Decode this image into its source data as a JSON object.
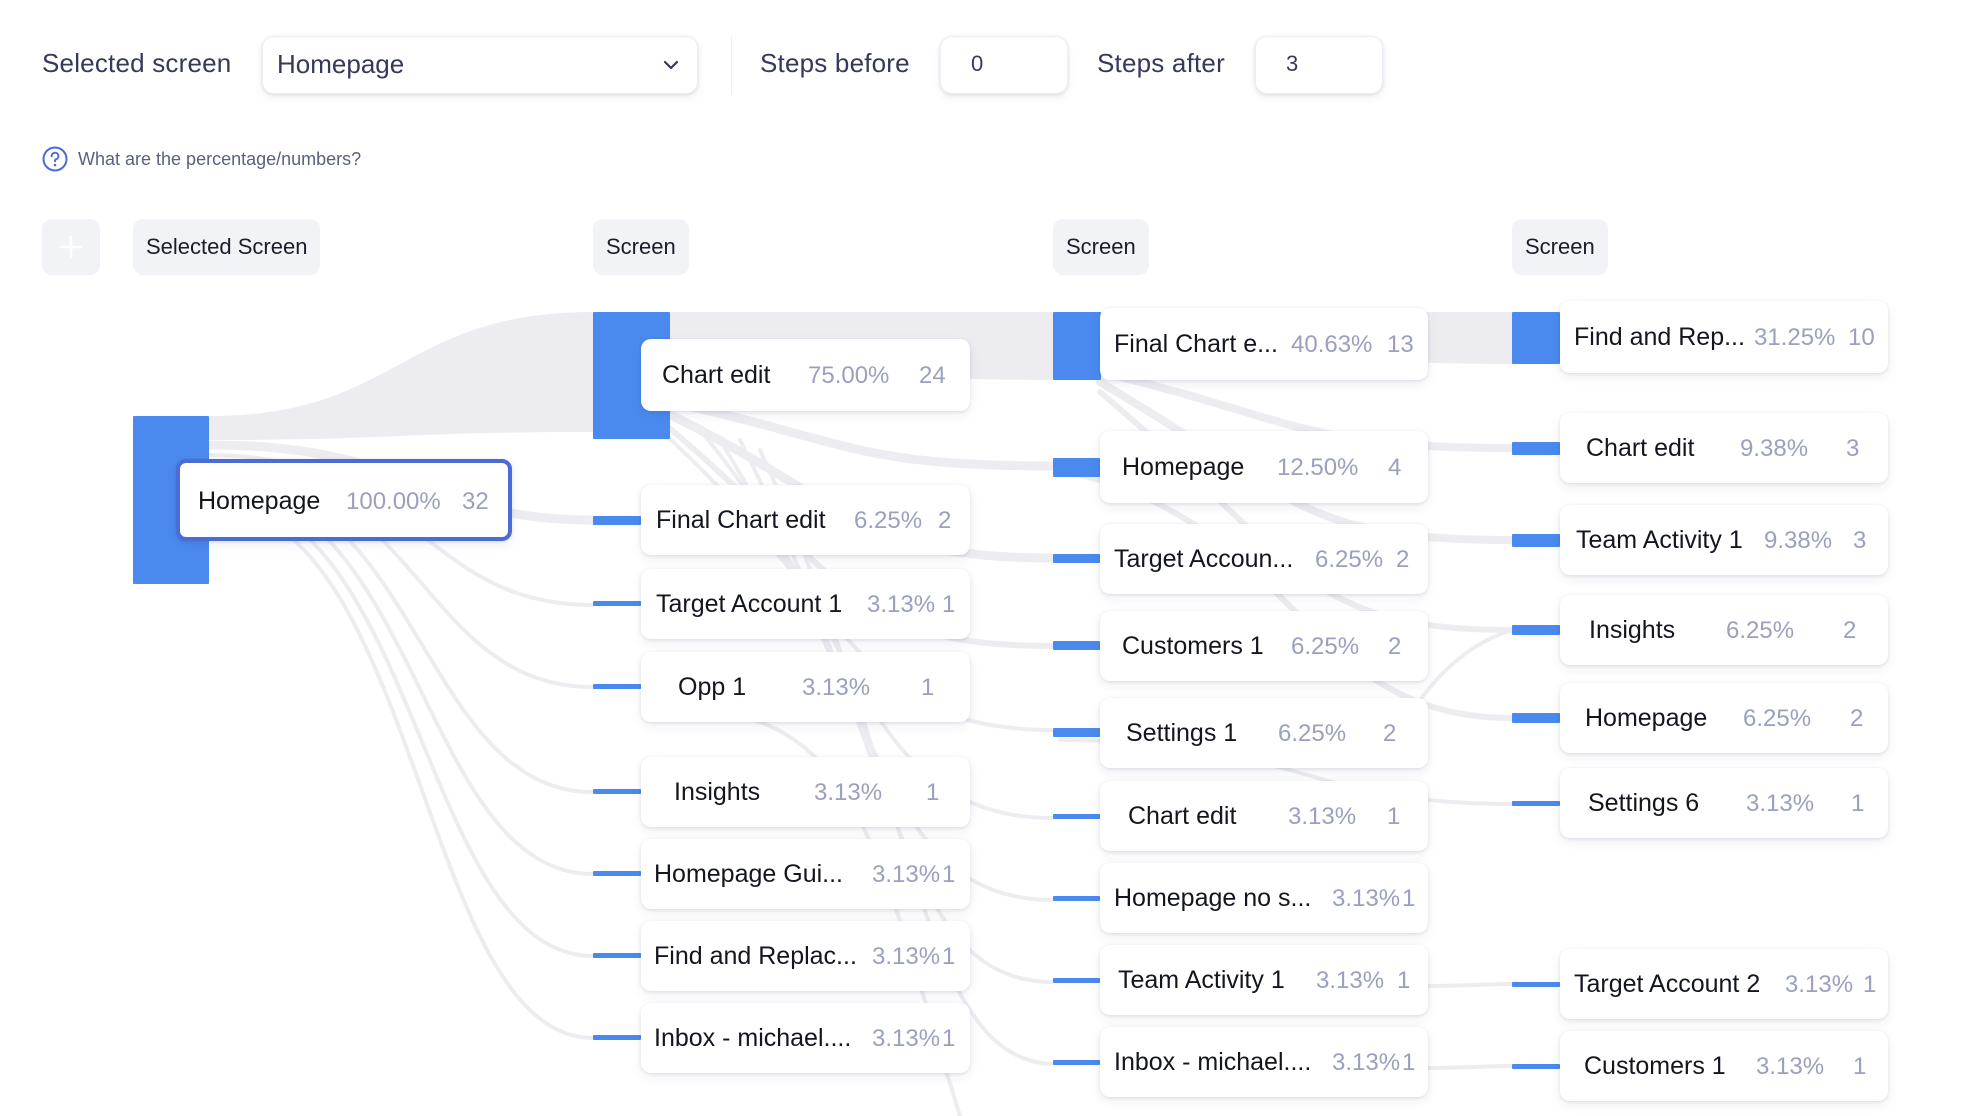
{
  "toolbar": {
    "selected_screen_label": "Selected screen",
    "selected_screen_value": "Homepage",
    "steps_before_label": "Steps before",
    "steps_before_value": "0",
    "steps_after_label": "Steps after",
    "steps_after_value": "3"
  },
  "help": {
    "text": "What are the percentage/numbers?"
  },
  "columns": {
    "col0": "Selected Screen",
    "col1": "Screen",
    "col2": "Screen",
    "col3": "Screen"
  },
  "nodes": {
    "root": {
      "name": "Homepage",
      "pct": "100.00%",
      "count": "32"
    },
    "c1": [
      {
        "name": "Chart edit",
        "pct": "75.00%",
        "count": "24"
      },
      {
        "name": "Final Chart edit",
        "pct": "6.25%",
        "count": "2"
      },
      {
        "name": "Target Account 1",
        "pct": "3.13%",
        "count": "1"
      },
      {
        "name": "Opp 1",
        "pct": "3.13%",
        "count": "1"
      },
      {
        "name": "Insights",
        "pct": "3.13%",
        "count": "1"
      },
      {
        "name": "Homepage Gui...",
        "pct": "3.13%",
        "count": "1"
      },
      {
        "name": "Find and Replac...",
        "pct": "3.13%",
        "count": "1"
      },
      {
        "name": "Inbox - michael....",
        "pct": "3.13%",
        "count": "1"
      }
    ],
    "c2": [
      {
        "name": "Final Chart e...",
        "pct": "40.63%",
        "count": "13"
      },
      {
        "name": "Homepage",
        "pct": "12.50%",
        "count": "4"
      },
      {
        "name": "Target Accoun...",
        "pct": "6.25%",
        "count": "2"
      },
      {
        "name": "Customers 1",
        "pct": "6.25%",
        "count": "2"
      },
      {
        "name": "Settings 1",
        "pct": "6.25%",
        "count": "2"
      },
      {
        "name": "Chart edit",
        "pct": "3.13%",
        "count": "1"
      },
      {
        "name": "Homepage no s...",
        "pct": "3.13%",
        "count": "1"
      },
      {
        "name": "Team Activity 1",
        "pct": "3.13%",
        "count": "1"
      },
      {
        "name": "Inbox - michael....",
        "pct": "3.13%",
        "count": "1"
      }
    ],
    "c3": [
      {
        "name": "Find and Rep...",
        "pct": "31.25%",
        "count": "10"
      },
      {
        "name": "Chart edit",
        "pct": "9.38%",
        "count": "3"
      },
      {
        "name": "Team Activity 1",
        "pct": "9.38%",
        "count": "3"
      },
      {
        "name": "Insights",
        "pct": "6.25%",
        "count": "2"
      },
      {
        "name": "Homepage",
        "pct": "6.25%",
        "count": "2"
      },
      {
        "name": "Settings 6",
        "pct": "3.13%",
        "count": "1"
      },
      {
        "name": "Target Account 2",
        "pct": "3.13%",
        "count": "1"
      },
      {
        "name": "Customers 1",
        "pct": "3.13%",
        "count": "1"
      }
    ]
  },
  "colors": {
    "bar": "#4a8aef",
    "flow": "#ededf1",
    "selected_border": "#4b6bd5"
  }
}
